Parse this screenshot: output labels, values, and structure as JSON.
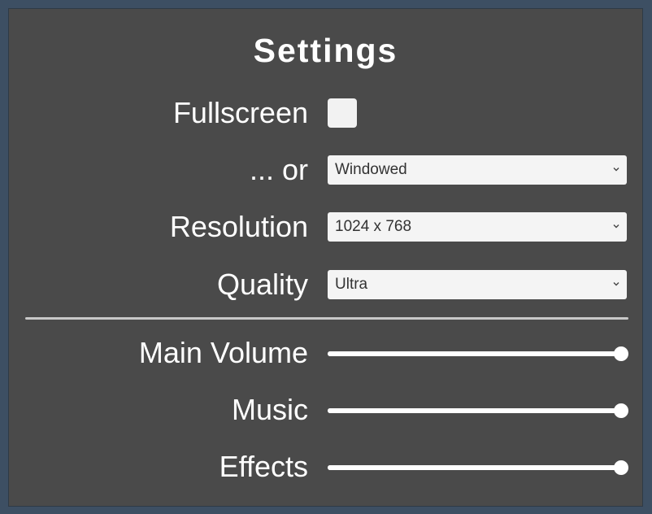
{
  "title": "Settings",
  "fullscreen": {
    "label": "Fullscreen",
    "checked": false
  },
  "window_mode": {
    "label": "... or",
    "selected": "Windowed"
  },
  "resolution": {
    "label": "Resolution",
    "selected": "1024 x 768"
  },
  "quality": {
    "label": "Quality",
    "selected": "Ultra"
  },
  "main_volume": {
    "label": "Main Volume",
    "value": 1.0
  },
  "music": {
    "label": "Music",
    "value": 1.0
  },
  "effects": {
    "label": "Effects",
    "value": 1.0
  },
  "icons": {
    "dropdown_arrow": "chevron-down-icon"
  },
  "colors": {
    "background": "#3d4f63",
    "panel": "#4a4a4a",
    "text": "#ffffff",
    "control": "#f4f4f4"
  }
}
